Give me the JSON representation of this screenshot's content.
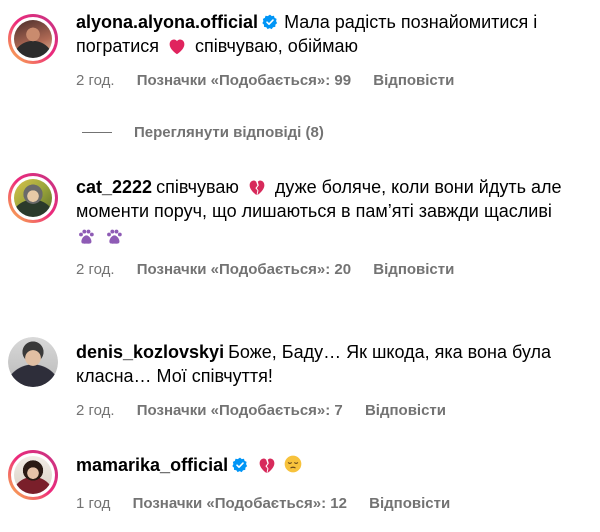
{
  "comments": [
    {
      "username": "alyona.alyona.official",
      "verified": true,
      "text_before_emoji": "Мала радість познайомитися і погратися",
      "emoji": "red-heart-icon",
      "text_after_emoji": "співчуваю, обіймаю",
      "time": "2 год.",
      "likes": "Позначки «Подобається»: 99",
      "reply": "Відповісти",
      "view_replies": "Переглянути відповіді (8)"
    },
    {
      "username": "cat_2222",
      "verified": false,
      "text_before_emoji": "співчуваю",
      "emoji": "broken-heart-icon",
      "text_after_emoji": "дуже боляче, коли вони йдуть але моменти поруч, що лишаються в пам’яті завжди щасливі",
      "extra_icons": [
        "paw-prints-icon",
        "paw-prints-icon"
      ],
      "time": "2 год.",
      "likes": "Позначки «Подобається»: 20",
      "reply": "Відповісти"
    },
    {
      "username": "denis_kozlovskyi",
      "verified": false,
      "text": "Боже, Баду… Як шкода, яка вона була класна… Мої співчуття!",
      "time": "2 год.",
      "likes": "Позначки «Подобається»: 7",
      "reply": "Відповісти"
    },
    {
      "username": "mamarika_official",
      "verified": true,
      "emojis": [
        "broken-heart-icon",
        "pensive-face-icon"
      ],
      "time": "1 год",
      "likes": "Позначки «Подобається»: 12",
      "reply": "Відповісти"
    }
  ],
  "colors": {
    "meta": "#737373",
    "verified": "#0095f6",
    "red_heart": "#e0245e",
    "broken_heart": "#d72a5b",
    "paw": "#8e5bb5"
  }
}
